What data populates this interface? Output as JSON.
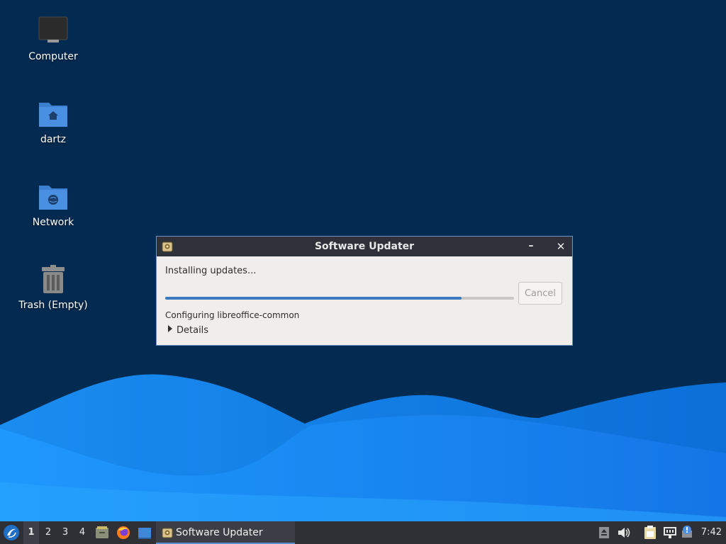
{
  "desktop": {
    "icons": [
      {
        "label": "Computer",
        "icon": "computer-icon"
      },
      {
        "label": "dartz",
        "icon": "home-folder-icon"
      },
      {
        "label": "Network",
        "icon": "network-folder-icon"
      },
      {
        "label": "Trash (Empty)",
        "icon": "trash-icon"
      }
    ]
  },
  "dialog": {
    "title": "Software Updater",
    "minimize_glyph": "–",
    "close_glyph": "✕",
    "status": "Installing updates...",
    "progress_fraction": 0.85,
    "cancel_label": "Cancel",
    "detail": "Configuring libreoffice-common",
    "details_label": "Details"
  },
  "taskbar": {
    "workspaces": [
      "1",
      "2",
      "3",
      "4"
    ],
    "active_workspace": "1",
    "launchers": [
      "file-manager-icon",
      "firefox-icon",
      "desktop-icon"
    ],
    "tasks": [
      {
        "label": "Software Updater",
        "icon": "software-updater-icon"
      }
    ],
    "tray": [
      "eject-icon",
      "volume-icon",
      "clipboard-icon",
      "network-wired-icon",
      "update-notifier-icon"
    ],
    "clock": "7:42"
  },
  "colors": {
    "desktop_bg": "#032a50",
    "wave_light": "#1e90ff",
    "taskbar_bg": "#2e3036",
    "titlebar_bg": "#2e3139",
    "progress": "#3b7bbd",
    "accent": "#5a8fd1"
  }
}
